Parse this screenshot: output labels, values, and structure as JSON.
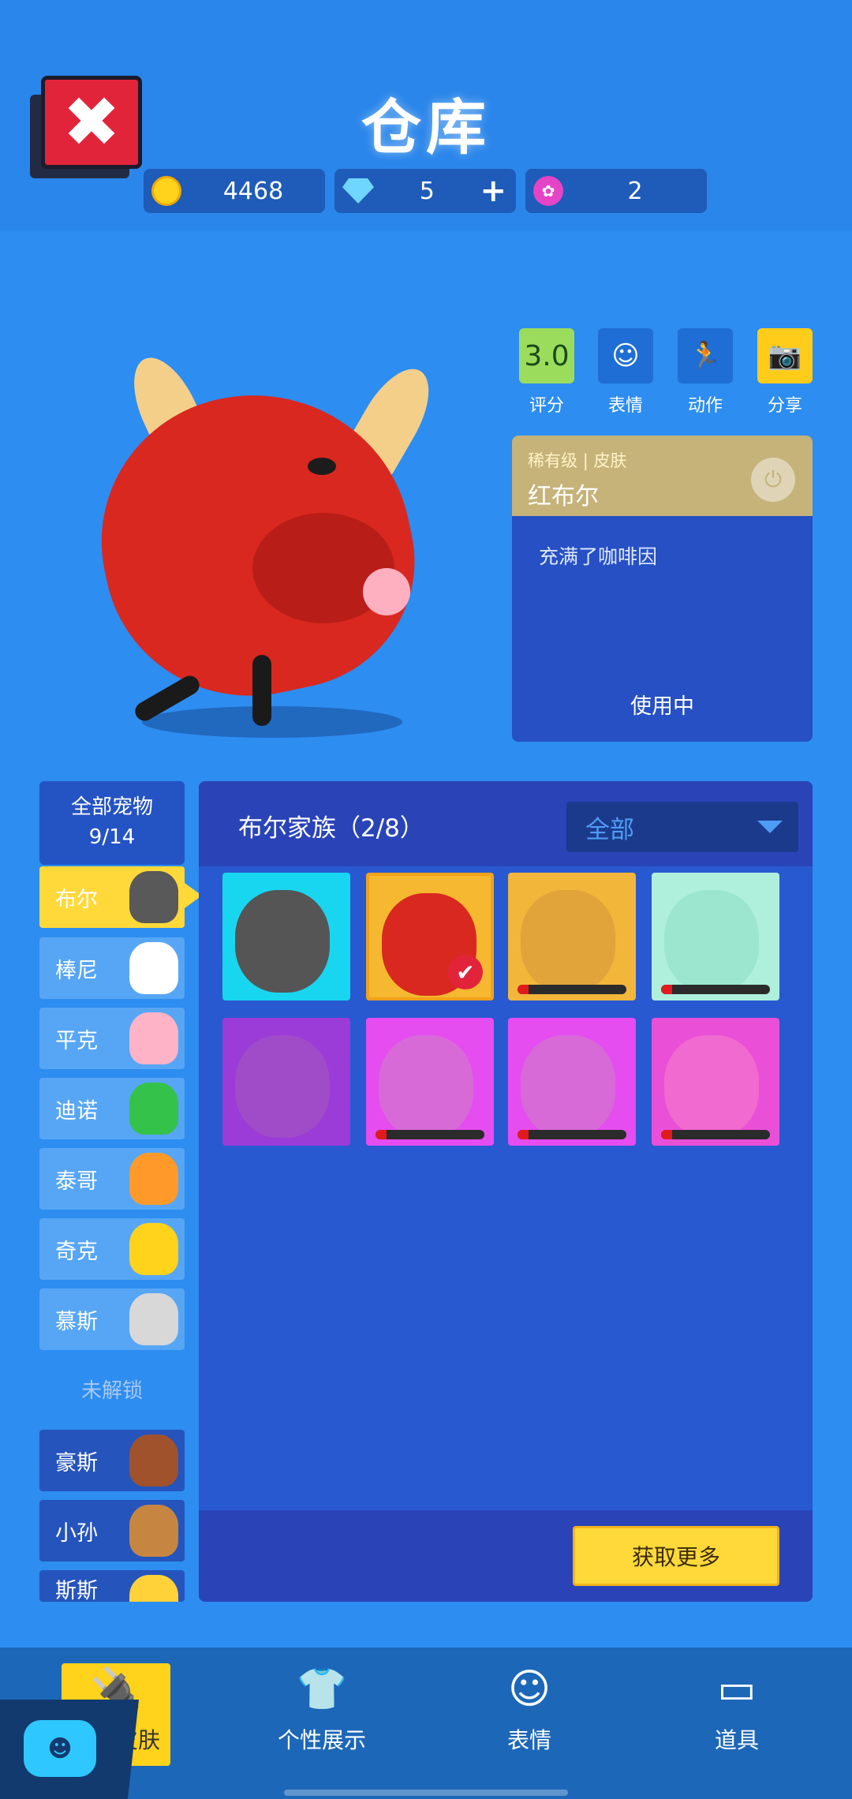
{
  "header": {
    "title": "仓库",
    "close_label": "✖",
    "currencies": [
      {
        "name": "coin-icon",
        "value": "4468"
      },
      {
        "name": "diamond-icon",
        "value": "5",
        "plus": "+"
      },
      {
        "name": "lotus-icon",
        "value": "2"
      }
    ]
  },
  "actions": [
    {
      "label": "评分",
      "value": "3.0",
      "color": "#9cdc5c"
    },
    {
      "label": "表情",
      "icon": "☺",
      "color": "#2d8df0"
    },
    {
      "label": "动作",
      "icon": "🏃",
      "color": "#2d8df0"
    },
    {
      "label": "分享",
      "icon": "📷",
      "color": "#ffcc1a"
    }
  ],
  "skin": {
    "rarity": "稀有级",
    "type": "皮肤",
    "separator": "|",
    "name": "红布尔",
    "description": "充满了咖啡因",
    "status": "使用中"
  },
  "pets": {
    "all_label": "全部宠物",
    "count": "9/14",
    "unlocked": [
      {
        "name": "布尔",
        "active": true,
        "color": "#595959"
      },
      {
        "name": "棒尼",
        "color": "#ffffff"
      },
      {
        "name": "平克",
        "color": "#ffb3c6"
      },
      {
        "name": "迪诺",
        "color": "#34c24a"
      },
      {
        "name": "泰哥",
        "color": "#ff9a2a"
      },
      {
        "name": "奇克",
        "color": "#ffd21c"
      },
      {
        "name": "慕斯",
        "color": "#d8d8d8"
      }
    ],
    "locked_label": "未解锁",
    "locked": [
      {
        "name": "豪斯",
        "color": "#a0522d"
      },
      {
        "name": "小孙",
        "color": "#c68642"
      },
      {
        "name": "斯斯",
        "color": "#ffd23a"
      }
    ]
  },
  "grid": {
    "title": "布尔家族（2/8）",
    "filter": "全部",
    "more_button": "获取更多",
    "tiles": [
      {
        "bg": "#19d6f0",
        "bull": "#555555",
        "owned": true
      },
      {
        "bg": "#f5b830",
        "bull": "#d9281f",
        "owned": true,
        "selected": true
      },
      {
        "bg": "#f2b63a",
        "bull": "#e0a43a",
        "progress": true
      },
      {
        "bg": "#aef0dc",
        "bull": "#9ce6cf",
        "progress": true
      },
      {
        "bg": "#9b3bd8",
        "bull": "#a04bc8"
      },
      {
        "bg": "#e54df0",
        "bull": "#d86ad8",
        "progress": true
      },
      {
        "bg": "#e54df0",
        "bull": "#d86ad8",
        "progress": true
      },
      {
        "bg": "#ea4fd8",
        "bull": "#f06ad0",
        "progress": true
      }
    ]
  },
  "tabs": [
    {
      "label": "宠物皮肤",
      "icon": "🔌",
      "active": true
    },
    {
      "label": "个性展示",
      "icon": "👕"
    },
    {
      "label": "表情",
      "icon": "☺"
    },
    {
      "label": "道具",
      "icon": "▭"
    }
  ]
}
